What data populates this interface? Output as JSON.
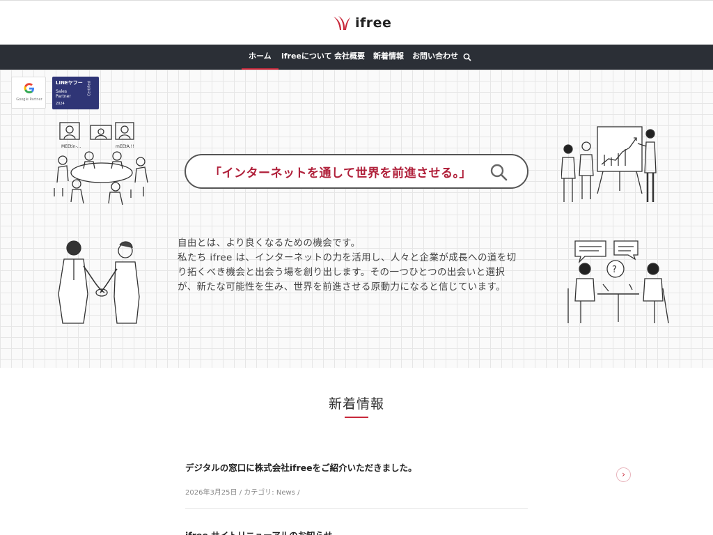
{
  "header": {
    "logo_text": "ifree"
  },
  "nav": {
    "items": [
      {
        "label": "ホーム",
        "active": true
      },
      {
        "label": "ifreeについて"
      },
      {
        "label": "会社概要"
      },
      {
        "label": "新着情報"
      },
      {
        "label": "お問い合わせ"
      }
    ],
    "search_icon": "search-icon"
  },
  "badges": {
    "google": {
      "label": "Google Partner"
    },
    "line": {
      "brand": "LINEヤフー",
      "line1": "Sales",
      "line2": "Partner",
      "year": "2024",
      "certified": "Certified"
    }
  },
  "hero": {
    "tagline": "「インターネットを通して世界を前進させる。」",
    "intro_lines": [
      "自由とは、より良くなるための機会です。",
      "私たち ifree は、インターネットの力を活用し、人々と企業が成長への道を切",
      "り拓くべき機会と出会う場を創り出します。その一つひとつの出会いと選択",
      "が、新たな可能性を生み、世界を前進させる原動力になると信じています。"
    ],
    "illustrations": {
      "meeting_labels": [
        "MEEtin-...",
        "mEEtA.!!"
      ],
      "bubble_q": "?"
    }
  },
  "news": {
    "heading": "新着情報",
    "items": [
      {
        "title": "デジタルの窓口に株式会社ifreeをご紹介いただきました。",
        "date": "2026年3月25日",
        "sep1": "/",
        "category": "カテゴリ: News",
        "sep2": "/"
      },
      {
        "title": "ifree サイトリニューアルのお知らせ"
      }
    ],
    "arrow_glyph": "›"
  },
  "colors": {
    "accent": "#c8283a",
    "nav_bg": "#2b2f36",
    "tagline": "#b0203a",
    "line_badge": "#2f3576"
  }
}
